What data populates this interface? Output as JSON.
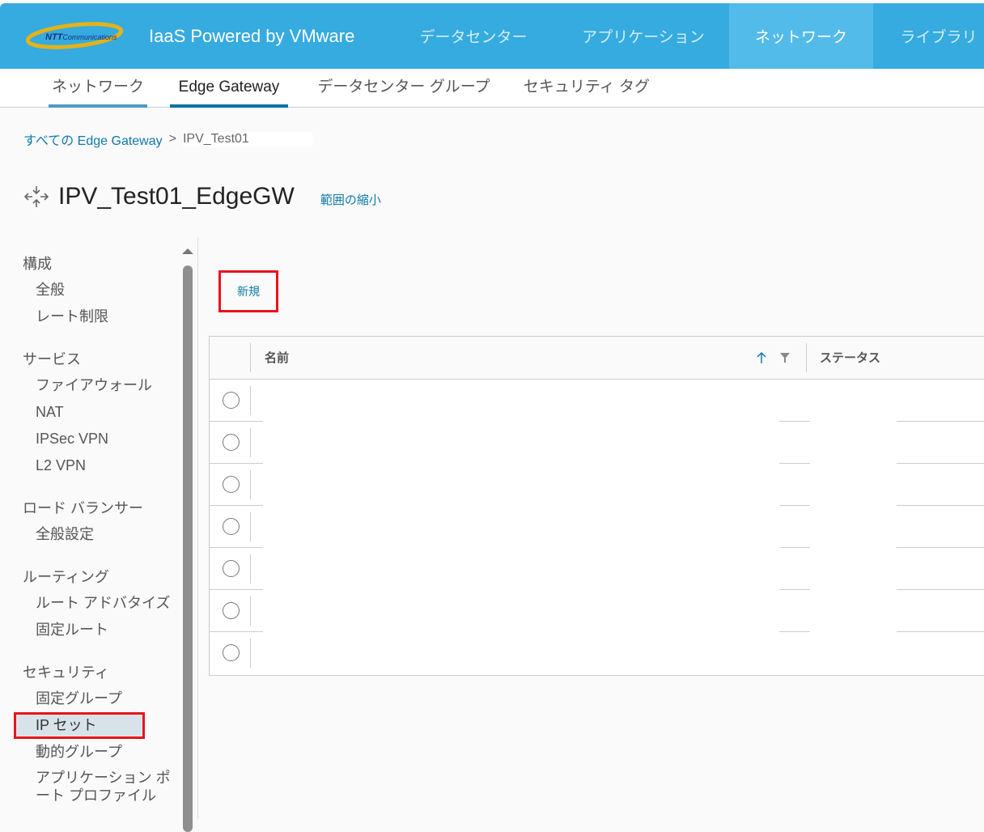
{
  "header": {
    "logo": "NTT Communications",
    "title": "IaaS Powered by VMware",
    "nav": [
      "データセンター",
      "アプリケーション",
      "ネットワーク",
      "ライブラリ"
    ],
    "active": "ネットワーク"
  },
  "subnav": [
    "ネットワーク",
    "Edge Gateway",
    "データセンター グループ",
    "セキュリティ タグ"
  ],
  "breadcrumb": {
    "parent": "すべての Edge Gateway",
    "separator": ">",
    "current": "IPV_Test01"
  },
  "page": {
    "title": "IPV_Test01_EdgeGW",
    "collapse": "範囲の縮小"
  },
  "sidebar": [
    {
      "section": "構成",
      "items": [
        "全般",
        "レート制限"
      ]
    },
    {
      "section": "サービス",
      "items": [
        "ファイアウォール",
        "NAT",
        "IPSec VPN",
        "L2 VPN"
      ]
    },
    {
      "section": "ロード バランサー",
      "items": [
        "全般設定"
      ]
    },
    {
      "section": "ルーティング",
      "items": [
        "ルート アドバタイズ",
        "固定ルート"
      ]
    },
    {
      "section": "セキュリティ",
      "items": [
        "固定グループ",
        "IP セット",
        "動的グループ",
        "アプリケーション ポ",
        "ート プロファイル"
      ]
    }
  ],
  "selected_item": "IP セット",
  "toolbar": {
    "new_label": "新規"
  },
  "table": {
    "columns": [
      "名前",
      "ステータス"
    ],
    "row_count": 7
  }
}
